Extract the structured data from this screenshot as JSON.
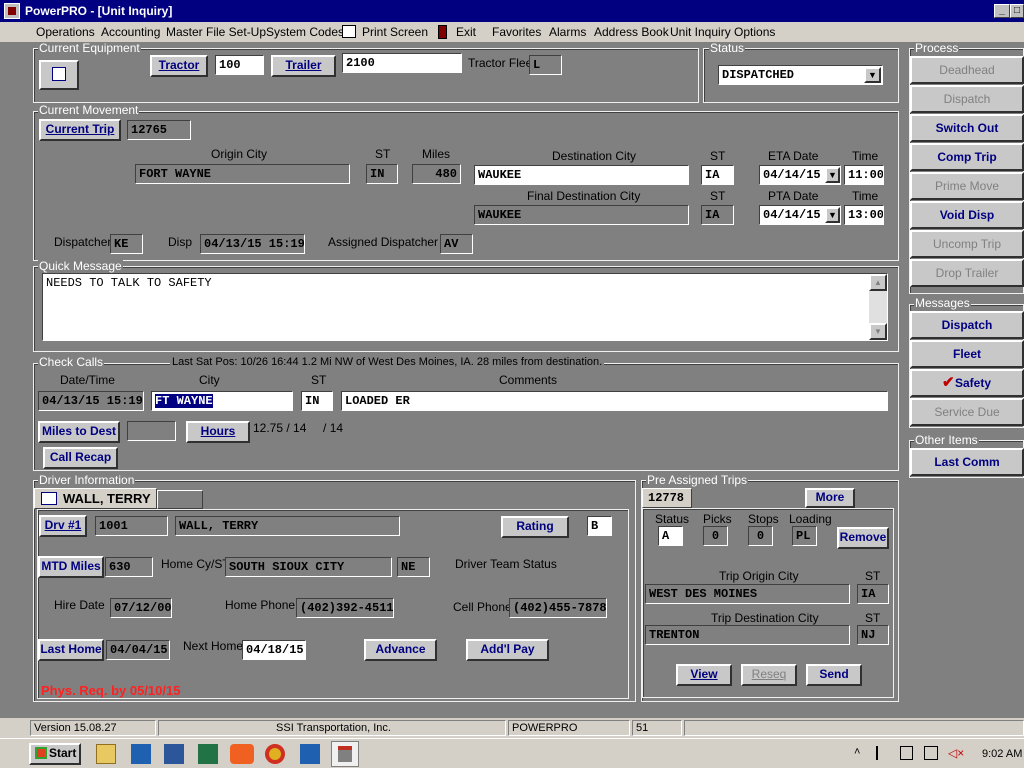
{
  "window": {
    "title": "PowerPRO - [Unit Inquiry]",
    "min": "_",
    "restore": "□"
  },
  "menu": [
    "Operations",
    "Accounting",
    "Master File Set-Up",
    "System Codes",
    "Print Screen",
    "Exit",
    "Favorites",
    "Alarms",
    "Address Book",
    "Unit Inquiry Options"
  ],
  "equipment": {
    "label": "Current Equipment",
    "tractor_btn": "Tractor",
    "tractor": "100",
    "trailer_btn": "Trailer",
    "trailer": "2100",
    "fleet_label": "Tractor Fleet",
    "fleet": "L"
  },
  "status": {
    "label": "Status",
    "value": "DISPATCHED"
  },
  "process": {
    "label": "Process",
    "buttons": [
      "Deadhead",
      "Dispatch",
      "Switch Out",
      "Comp Trip",
      "Prime Move",
      "Void Disp",
      "Uncomp Trip",
      "Drop Trailer"
    ]
  },
  "movement": {
    "label": "Current Movement",
    "trip_btn": "Current Trip",
    "trip": "12765",
    "h_origin": "Origin City",
    "h_st": "ST",
    "h_miles": "Miles",
    "h_dest": "Destination City",
    "h_st2": "ST",
    "h_eta": "ETA Date",
    "h_time": "Time",
    "origin": "FORT WAYNE",
    "origin_st": "IN",
    "miles": "480",
    "dest": "WAUKEE",
    "dest_st": "IA",
    "eta": "04/14/15",
    "eta_time": "11:00",
    "h_final": "Final Destination City",
    "h_st3": "ST",
    "h_pta": "PTA Date",
    "h_time2": "Time",
    "final": "WAUKEE",
    "final_st": "IA",
    "pta": "04/14/15",
    "pta_time": "13:00",
    "dispatcher_label": "Dispatcher",
    "dispatcher": "KE",
    "disp_label": "Disp",
    "disp": "04/13/15 15:19",
    "assigned_label": "Assigned Dispatcher",
    "assigned": "AV"
  },
  "quick": {
    "label": "Quick Message",
    "text": "NEEDS TO TALK TO SAFETY"
  },
  "messages": {
    "label": "Messages",
    "buttons": [
      "Dispatch",
      "Fleet",
      "Safety",
      "Service Due"
    ]
  },
  "other": {
    "label": "Other Items",
    "button": "Last Comm"
  },
  "checkcalls": {
    "label": "Check Calls",
    "info": "Last Sat Pos: 10/26 16:44  1.2 Mi  NW of West Des Moines, IA.  28 miles from destination.",
    "h_dt": "Date/Time",
    "h_city": "City",
    "h_st": "ST",
    "h_comments": "Comments",
    "dt": "04/13/15 15:19",
    "city": "FT WAYNE",
    "st": "IN",
    "comments": "LOADED ER",
    "miles_btn": "Miles to Dest",
    "miles": "",
    "hours_btn": "Hours",
    "hours": "12.75 / 14     / 14",
    "recap_btn": "Call Recap"
  },
  "driver": {
    "label": "Driver Information",
    "tab": "WALL, TERRY",
    "drv_btn": "Drv #1",
    "drv_no": "1001",
    "drv_name": "WALL, TERRY",
    "rating_btn": "Rating",
    "rating": "B",
    "mtd_btn": "MTD Miles",
    "mtd": "630",
    "home_label": "Home Cy/ST",
    "home_city": "SOUTH SIOUX CITY",
    "home_st": "NE",
    "team_label": "Driver Team Status",
    "hire_label": "Hire Date",
    "hire": "07/12/00",
    "hphone_label": "Home Phone",
    "hphone": "(402)392-4511",
    "cphone_label": "Cell Phone",
    "cphone": "(402)455-7878",
    "lasthome_btn": "Last Home",
    "lasthome": "04/04/15",
    "nexthome_label": "Next Home",
    "nexthome": "04/18/15",
    "advance_btn": "Advance",
    "addpay_btn": "Add'l Pay",
    "phys": "Phys. Req. by 05/10/15"
  },
  "preassigned": {
    "label": "Pre Assigned Trips",
    "trip": "12778",
    "more_btn": "More",
    "h_status": "Status",
    "h_picks": "Picks",
    "h_stops": "Stops",
    "h_loading": "Loading",
    "status": "A",
    "picks": "0",
    "stops": "0",
    "loading": "PL",
    "remove_btn": "Remove",
    "h_origin": "Trip Origin City",
    "h_st": "ST",
    "origin": "WEST DES MOINES",
    "origin_st": "IA",
    "h_dest": "Trip Destination City",
    "h_st2": "ST",
    "dest": "TRENTON",
    "dest_st": "NJ",
    "view_btn": "View",
    "reseq_btn": "Reseq",
    "send_btn": "Send"
  },
  "statusbar": {
    "version": "Version 15.08.27",
    "company": "SSI Transportation, Inc.",
    "app": "POWERPRO",
    "num": "51"
  },
  "taskbar": {
    "start": "Start",
    "clock": "9:02 AM"
  }
}
